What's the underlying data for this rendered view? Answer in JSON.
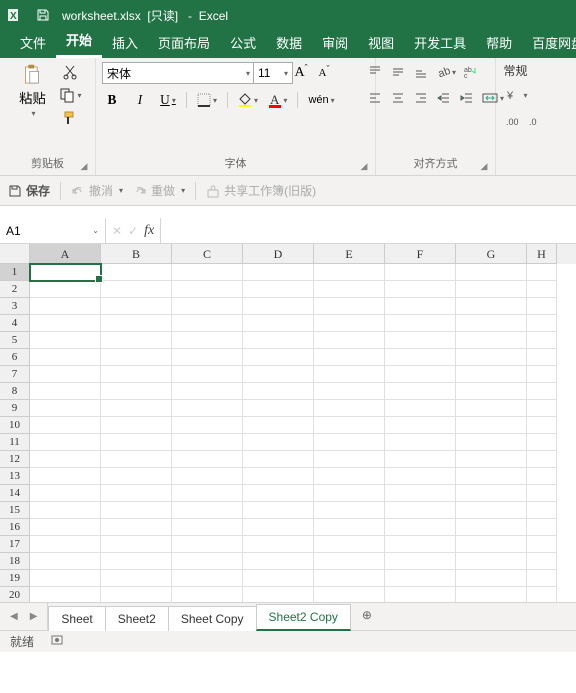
{
  "titlebar": {
    "filename": "worksheet.xlsx",
    "readonly_tag": "[只读]",
    "appname": "Excel"
  },
  "tabs": {
    "file": "文件",
    "home": "开始",
    "insert": "插入",
    "layout": "页面布局",
    "formulas": "公式",
    "data": "数据",
    "review": "审阅",
    "view": "视图",
    "dev": "开发工具",
    "help": "帮助",
    "baidu": "百度网盘"
  },
  "ribbon": {
    "clipboard": {
      "paste": "粘贴",
      "title": "剪贴板"
    },
    "font": {
      "name": "宋体",
      "size": "11",
      "title": "字体",
      "wen": "wén"
    },
    "align": {
      "title": "对齐方式"
    },
    "number": {
      "general": "常规"
    }
  },
  "qat": {
    "save": "保存",
    "undo": "撤消",
    "redo": "重做",
    "share": "共享工作簿(旧版)"
  },
  "namebox": {
    "value": "A1"
  },
  "grid": {
    "cols": [
      "A",
      "B",
      "C",
      "D",
      "E",
      "F",
      "G",
      "H"
    ],
    "rows": [
      "1",
      "2",
      "3",
      "4",
      "5",
      "6",
      "7",
      "8",
      "9",
      "10",
      "11",
      "12",
      "13",
      "14",
      "15",
      "16",
      "17",
      "18",
      "19",
      "20"
    ],
    "active": "A1"
  },
  "sheets": {
    "items": [
      "Sheet",
      "Sheet2",
      "Sheet Copy",
      "Sheet2 Copy"
    ],
    "active_index": 3
  },
  "status": {
    "ready": "就绪"
  }
}
